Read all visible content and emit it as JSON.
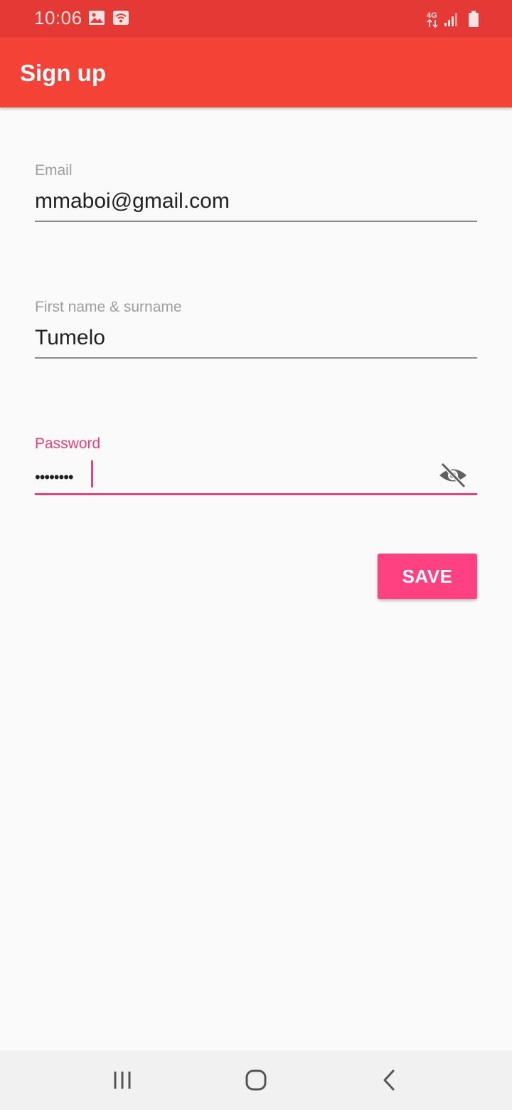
{
  "status_bar": {
    "time": "10:06",
    "icons": [
      "image-icon",
      "wifi-call-icon",
      "4g-icon",
      "signal-icon",
      "battery-icon"
    ],
    "network": "4G"
  },
  "app_bar": {
    "title": "Sign up"
  },
  "form": {
    "email": {
      "label": "Email",
      "value": "mmaboi@gmail.com"
    },
    "name": {
      "label": "First name & surname",
      "value": "Tumelo"
    },
    "password": {
      "label": "Password",
      "value": "••••••••",
      "toggle_icon": "visibility-off-icon",
      "focused": true
    },
    "save_label": "SAVE"
  },
  "nav_bar": {
    "icons": [
      "recent-apps-icon",
      "home-icon",
      "back-icon"
    ]
  },
  "colors": {
    "status_bar": "#e53935",
    "app_bar": "#f44336",
    "accent": "#ff4081",
    "focus": "#ec407a",
    "background": "#fafafa"
  }
}
